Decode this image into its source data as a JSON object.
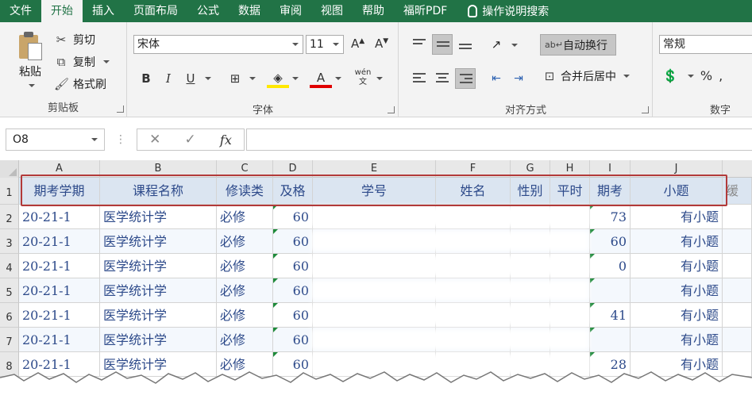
{
  "menubar": {
    "tabs": [
      "文件",
      "开始",
      "插入",
      "页面布局",
      "公式",
      "数据",
      "审阅",
      "视图",
      "帮助",
      "福昕PDF"
    ],
    "active_tab": "开始",
    "tell_me": "操作说明搜索"
  },
  "ribbon": {
    "clipboard": {
      "paste": "粘贴",
      "cut": "剪切",
      "copy": "复制",
      "format_painter": "格式刷",
      "label": "剪贴板"
    },
    "font": {
      "name": "宋体",
      "size": "11",
      "label": "字体",
      "phonetic": "wén 文"
    },
    "alignment": {
      "wrap_text": "自动换行",
      "merge_center": "合并后居中",
      "label": "对齐方式"
    },
    "number": {
      "format": "常规",
      "label": "数字"
    }
  },
  "formula_bar": {
    "name_box": "O8",
    "fx": "fx",
    "content": ""
  },
  "grid": {
    "columns": [
      "A",
      "B",
      "C",
      "D",
      "E",
      "F",
      "G",
      "H",
      "I",
      "J"
    ],
    "header_row": [
      "期考学期",
      "课程名称",
      "修读类",
      "及格",
      "学号",
      "姓名",
      "性别",
      "平时",
      "期考",
      "小题",
      "缓"
    ],
    "rows": [
      {
        "num": "1"
      },
      {
        "num": "2",
        "cells": [
          "20-21-1",
          "医学统计学",
          "必修",
          "60",
          "",
          "",
          "",
          "",
          "73",
          "有小题"
        ]
      },
      {
        "num": "3",
        "cells": [
          "20-21-1",
          "医学统计学",
          "必修",
          "60",
          "",
          "",
          "",
          "",
          "60",
          "有小题"
        ]
      },
      {
        "num": "4",
        "cells": [
          "20-21-1",
          "医学统计学",
          "必修",
          "60",
          "",
          "",
          "",
          "",
          "0",
          "有小题"
        ]
      },
      {
        "num": "5",
        "cells": [
          "20-21-1",
          "医学统计学",
          "必修",
          "60",
          "",
          "",
          "",
          "",
          "",
          "有小题"
        ]
      },
      {
        "num": "6",
        "cells": [
          "20-21-1",
          "医学统计学",
          "必修",
          "60",
          "",
          "",
          "",
          "",
          "41",
          "有小题"
        ]
      },
      {
        "num": "7",
        "cells": [
          "20-21-1",
          "医学统计学",
          "必修",
          "60",
          "",
          "",
          "",
          "",
          "",
          "有小题"
        ]
      },
      {
        "num": "8",
        "cells": [
          "20-21-1",
          "医学统计学",
          "必修",
          "60",
          "",
          "",
          "",
          "",
          "28",
          "有小题"
        ]
      }
    ]
  },
  "colors": {
    "excel_green": "#217346",
    "highlight_red": "#b23a3a",
    "cell_text": "#2d4a8a"
  }
}
